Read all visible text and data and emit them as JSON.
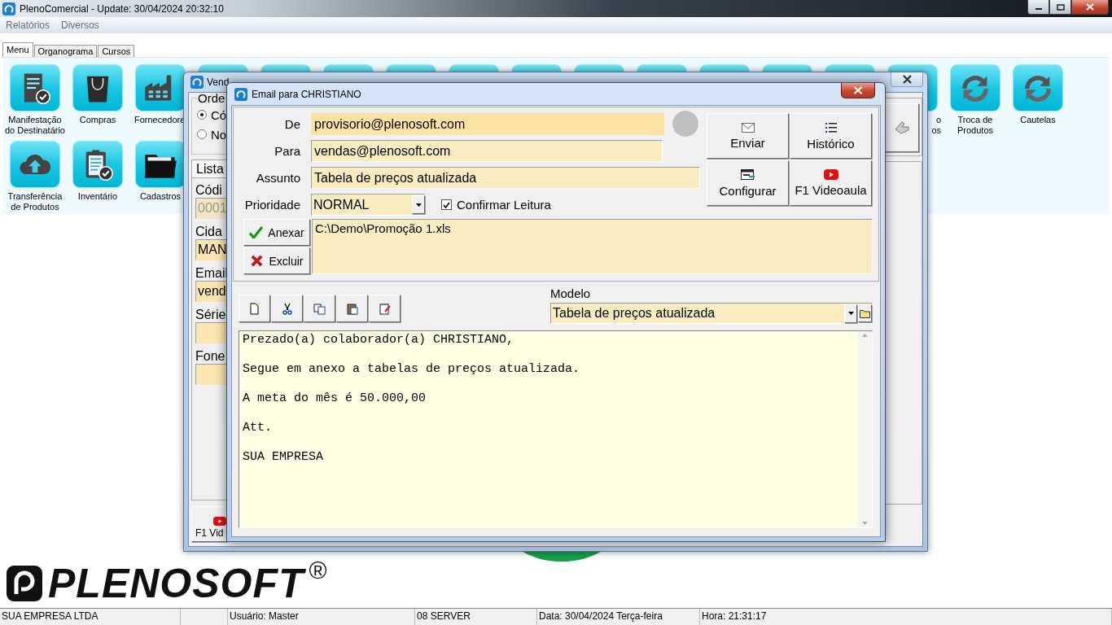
{
  "app": {
    "title": "PlenoComercial - Update: 30/04/2024 20:32:10"
  },
  "menu": [
    {
      "label": "Relatórios"
    },
    {
      "label": "Diversos"
    }
  ],
  "tabs": [
    {
      "label": "Menu",
      "selected": true
    },
    {
      "label": "Organograma",
      "selected": false
    },
    {
      "label": "Cursos",
      "selected": false
    }
  ],
  "launcher": {
    "row_1_left": [
      {
        "label": [
          "Manifestação",
          "do Destinatário"
        ]
      },
      {
        "label": [
          "Compras"
        ]
      },
      {
        "label": [
          "Fornecedore"
        ],
        "cut": true
      }
    ],
    "row_1_right": [
      {
        "label": [
          "o",
          "os"
        ],
        "cut": true
      },
      {
        "label": [
          "Troca de",
          "Produtos"
        ],
        "cut": false
      },
      {
        "label": [
          "Cautelas"
        ],
        "cut": false
      }
    ],
    "row_2": [
      {
        "label": [
          "Transferência",
          "de Produtos"
        ]
      },
      {
        "label": [
          "Inventário"
        ]
      },
      {
        "label": [
          "Cadastros"
        ]
      }
    ]
  },
  "logo": {
    "name": "PLENOSOFT",
    "mark": "®"
  },
  "vendedores_window": {
    "title": "Vend",
    "group": {
      "legend": "Orde",
      "options": [
        {
          "label": "Có",
          "selected": true
        },
        {
          "label": "No",
          "selected": false
        }
      ]
    },
    "tab": "Lista",
    "fields": [
      {
        "label": "Códi",
        "value": "0001",
        "disabled": true
      },
      {
        "label": "Cida",
        "value": "MAN",
        "disabled": false
      },
      {
        "label": "Email",
        "value": "vend",
        "disabled": false
      },
      {
        "label": "Série",
        "disabled": false
      },
      {
        "label": "Fone",
        "disabled": false
      }
    ],
    "video_button": "F1 Vid"
  },
  "email_window": {
    "title": "Email para CHRISTIANO",
    "fields": [
      {
        "label": "De",
        "value": "provisorio@plenosoft.com",
        "focused": true
      },
      {
        "label": "Para",
        "value": "vendas@plenosoft.com",
        "focused": false
      },
      {
        "label": "Assunto",
        "value": "Tabela de preços atualizada",
        "focused": false
      }
    ],
    "priority": {
      "label": "Prioridade",
      "value": "NORMAL"
    },
    "confirm": {
      "label": "Confirmar Leitura",
      "checked": true
    },
    "actions": [
      {
        "label": "Enviar"
      },
      {
        "label": "Histórico"
      },
      {
        "label": "Configurar"
      },
      {
        "label": "F1 Videoaula"
      }
    ],
    "attach_buttons": [
      {
        "label": "Anexar"
      },
      {
        "label": "Excluir"
      }
    ],
    "attachments": [
      "C:\\Demo\\Promoção 1.xls"
    ],
    "model": {
      "label": "Modelo",
      "value": "Tabela de preços atualizada"
    },
    "body": [
      "Prezado(a) colaborador(a) CHRISTIANO,",
      "Segue em anexo a tabelas de preços atualizada.",
      "A meta do mês é 50.000,00",
      "Att.",
      "SUA EMPRESA"
    ]
  },
  "status_bar": [
    {
      "text": "SUA EMPRESA LTDA"
    },
    {
      "text": "Usuário: Master"
    },
    {
      "text": "08 SERVER"
    },
    {
      "text": "Data: 30/04/2024 Terça-feira"
    },
    {
      "text": "Hora: 21:31:17"
    }
  ]
}
